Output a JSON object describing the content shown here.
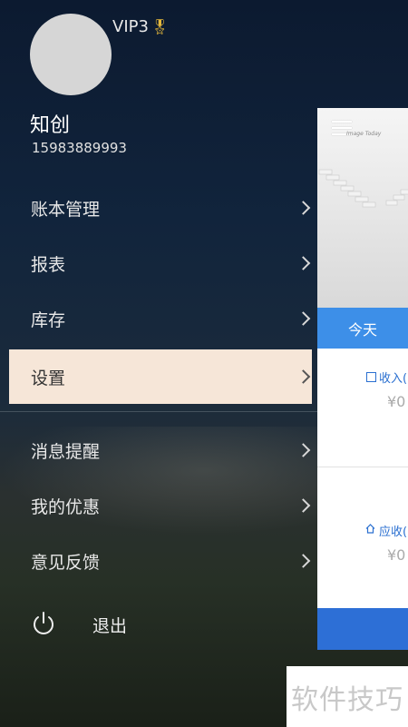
{
  "profile": {
    "vip_label": "VIP3",
    "name": "知创",
    "phone": "15983889993"
  },
  "menu": {
    "items": [
      {
        "label": "账本管理"
      },
      {
        "label": "报表"
      },
      {
        "label": "库存"
      },
      {
        "label": "设置",
        "active": true
      },
      {
        "label": "消息提醒"
      },
      {
        "label": "我的优惠"
      },
      {
        "label": "意见反馈"
      }
    ],
    "logout_label": "退出"
  },
  "main_panel": {
    "banner_text": "Image Today",
    "today_tab": "今天",
    "income_label": "收入(",
    "income_value": "¥0",
    "receivable_label": "应收(",
    "receivable_value": "¥0",
    "accent_color": "#3d8fe8"
  },
  "watermark": "软件技巧"
}
